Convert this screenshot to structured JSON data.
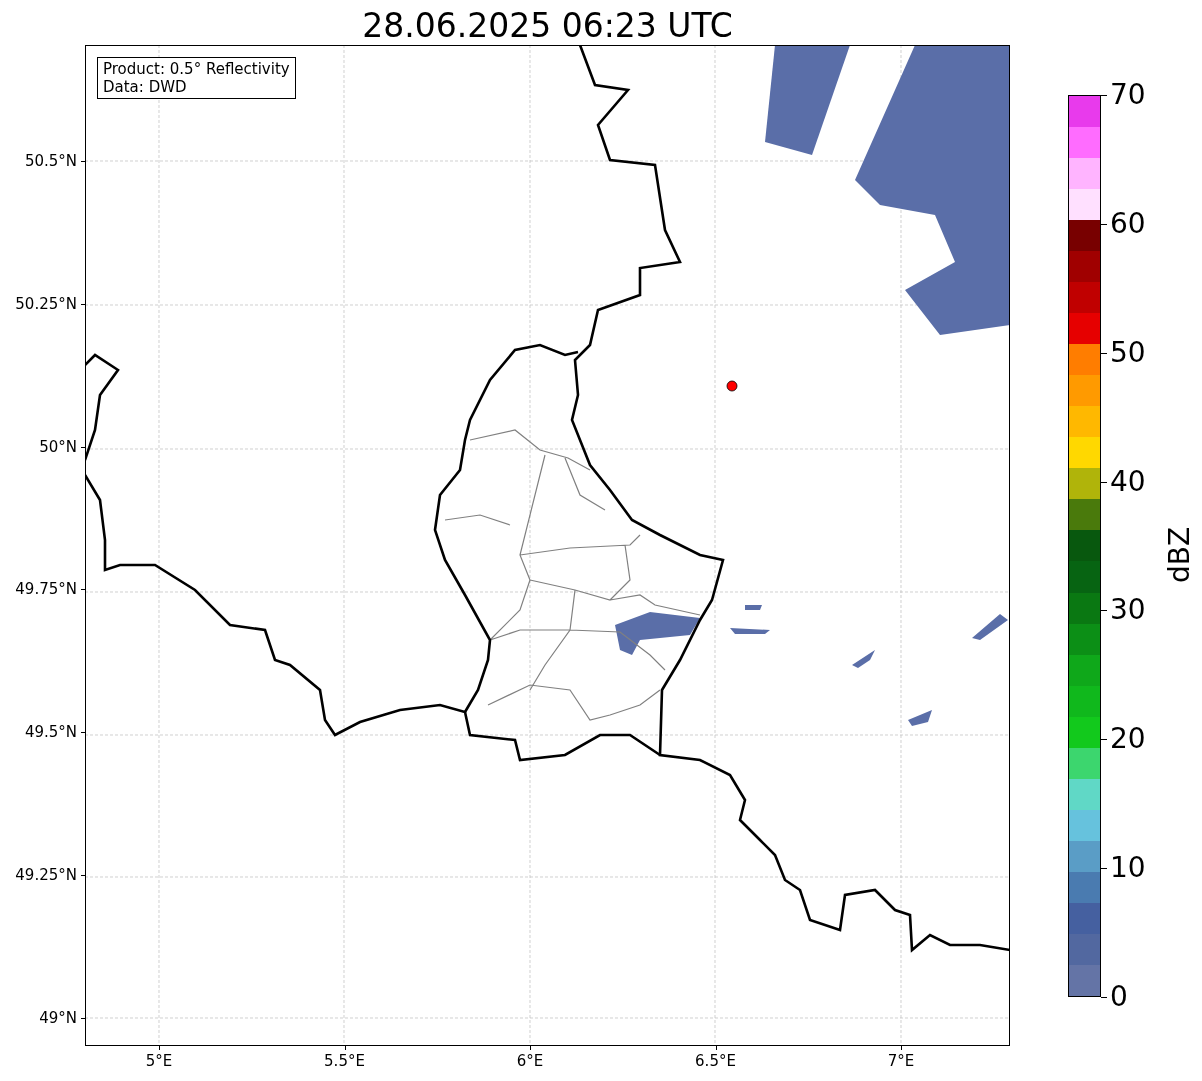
{
  "title": "28.06.2025 06:23 UTC",
  "info_box": [
    "Product: 0.5° Reflectivity",
    "Data: DWD"
  ],
  "map": {
    "y_tick_labels": [
      "50.5°N",
      "50.25°N",
      "50°N",
      "49.75°N",
      "49.5°N",
      "49.25°N",
      "49°N"
    ],
    "x_tick_labels": [
      "5°E",
      "5.5°E",
      "6°E",
      "6.5°E",
      "7°E"
    ]
  },
  "colorbar": {
    "label": "dBZ",
    "ticks": [
      "70",
      "60",
      "50",
      "40",
      "30",
      "20",
      "10",
      "0"
    ],
    "bins": [
      {
        "color": "#e83aec"
      },
      {
        "color": "#ff6cff"
      },
      {
        "color": "#ffb4ff"
      },
      {
        "color": "#ffe0ff"
      },
      {
        "color": "#780000"
      },
      {
        "color": "#a00000"
      },
      {
        "color": "#c00000"
      },
      {
        "color": "#e60000"
      },
      {
        "color": "#ff7d00"
      },
      {
        "color": "#ff9a00"
      },
      {
        "color": "#ffb800"
      },
      {
        "color": "#ffd800"
      },
      {
        "color": "#b0b40a"
      },
      {
        "color": "#4a7a0c"
      },
      {
        "color": "#08580e"
      },
      {
        "color": "#076412"
      },
      {
        "color": "#0a7812"
      },
      {
        "color": "#0c8f16"
      },
      {
        "color": "#0fa81a"
      },
      {
        "color": "#10b81c"
      },
      {
        "color": "#12c91c"
      },
      {
        "color": "#3cd66e"
      },
      {
        "color": "#60d8c6"
      },
      {
        "color": "#66c2dd"
      },
      {
        "color": "#5a9dc6"
      },
      {
        "color": "#4a7bb0"
      },
      {
        "color": "#4560a0"
      },
      {
        "color": "#5268a0"
      },
      {
        "color": "#6474a6"
      }
    ]
  }
}
